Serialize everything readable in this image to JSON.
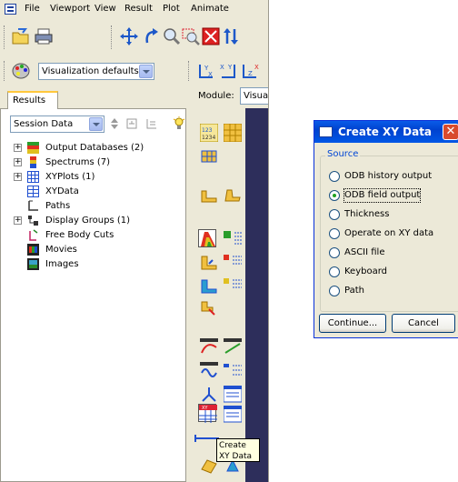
{
  "menubar": {
    "items": [
      {
        "id": "file",
        "label": "File"
      },
      {
        "id": "viewport",
        "label": "Viewport"
      },
      {
        "id": "view",
        "label": "View"
      },
      {
        "id": "result",
        "label": "Result"
      },
      {
        "id": "plot",
        "label": "Plot"
      },
      {
        "id": "animate",
        "label": "Animate"
      }
    ]
  },
  "toolbar": {
    "visualization_select": "Visualization defaults"
  },
  "results_panel": {
    "tab_label": "Results",
    "session_select": "Session Data",
    "tree": [
      {
        "label": "Output Databases (2)",
        "expandable": true,
        "icon": "database-icon"
      },
      {
        "label": "Spectrums (7)",
        "expandable": true,
        "icon": "spectrum-icon"
      },
      {
        "label": "XYPlots (1)",
        "expandable": true,
        "icon": "xyplot-icon"
      },
      {
        "label": "XYData",
        "expandable": false,
        "icon": "xydata-icon"
      },
      {
        "label": "Paths",
        "expandable": false,
        "icon": "path-icon"
      },
      {
        "label": "Display Groups (1)",
        "expandable": true,
        "icon": "display-group-icon"
      },
      {
        "label": "Free Body Cuts",
        "expandable": false,
        "icon": "free-body-cut-icon"
      },
      {
        "label": "Movies",
        "expandable": false,
        "icon": "movie-icon"
      },
      {
        "label": "Images",
        "expandable": false,
        "icon": "image-icon"
      }
    ]
  },
  "module": {
    "label": "Module:",
    "value": "Visua"
  },
  "tooltip": {
    "line1": "Create",
    "line2": "XY Data"
  },
  "dialog": {
    "title": "Create XY Data",
    "close_glyph": "✕",
    "group_label": "Source",
    "options": [
      {
        "label": "ODB history output",
        "selected": false
      },
      {
        "label": "ODB field output",
        "selected": true
      },
      {
        "label": "Thickness",
        "selected": false
      },
      {
        "label": "Operate on XY data",
        "selected": false
      },
      {
        "label": "ASCII file",
        "selected": false
      },
      {
        "label": "Keyboard",
        "selected": false
      },
      {
        "label": "Path",
        "selected": false
      }
    ],
    "continue_label": "Continue...",
    "cancel_label": "Cancel"
  },
  "colors": {
    "titlebar": "#0042cf",
    "viewport_bg": "#2d2e5b",
    "tab_accent": "#ffc83c"
  }
}
